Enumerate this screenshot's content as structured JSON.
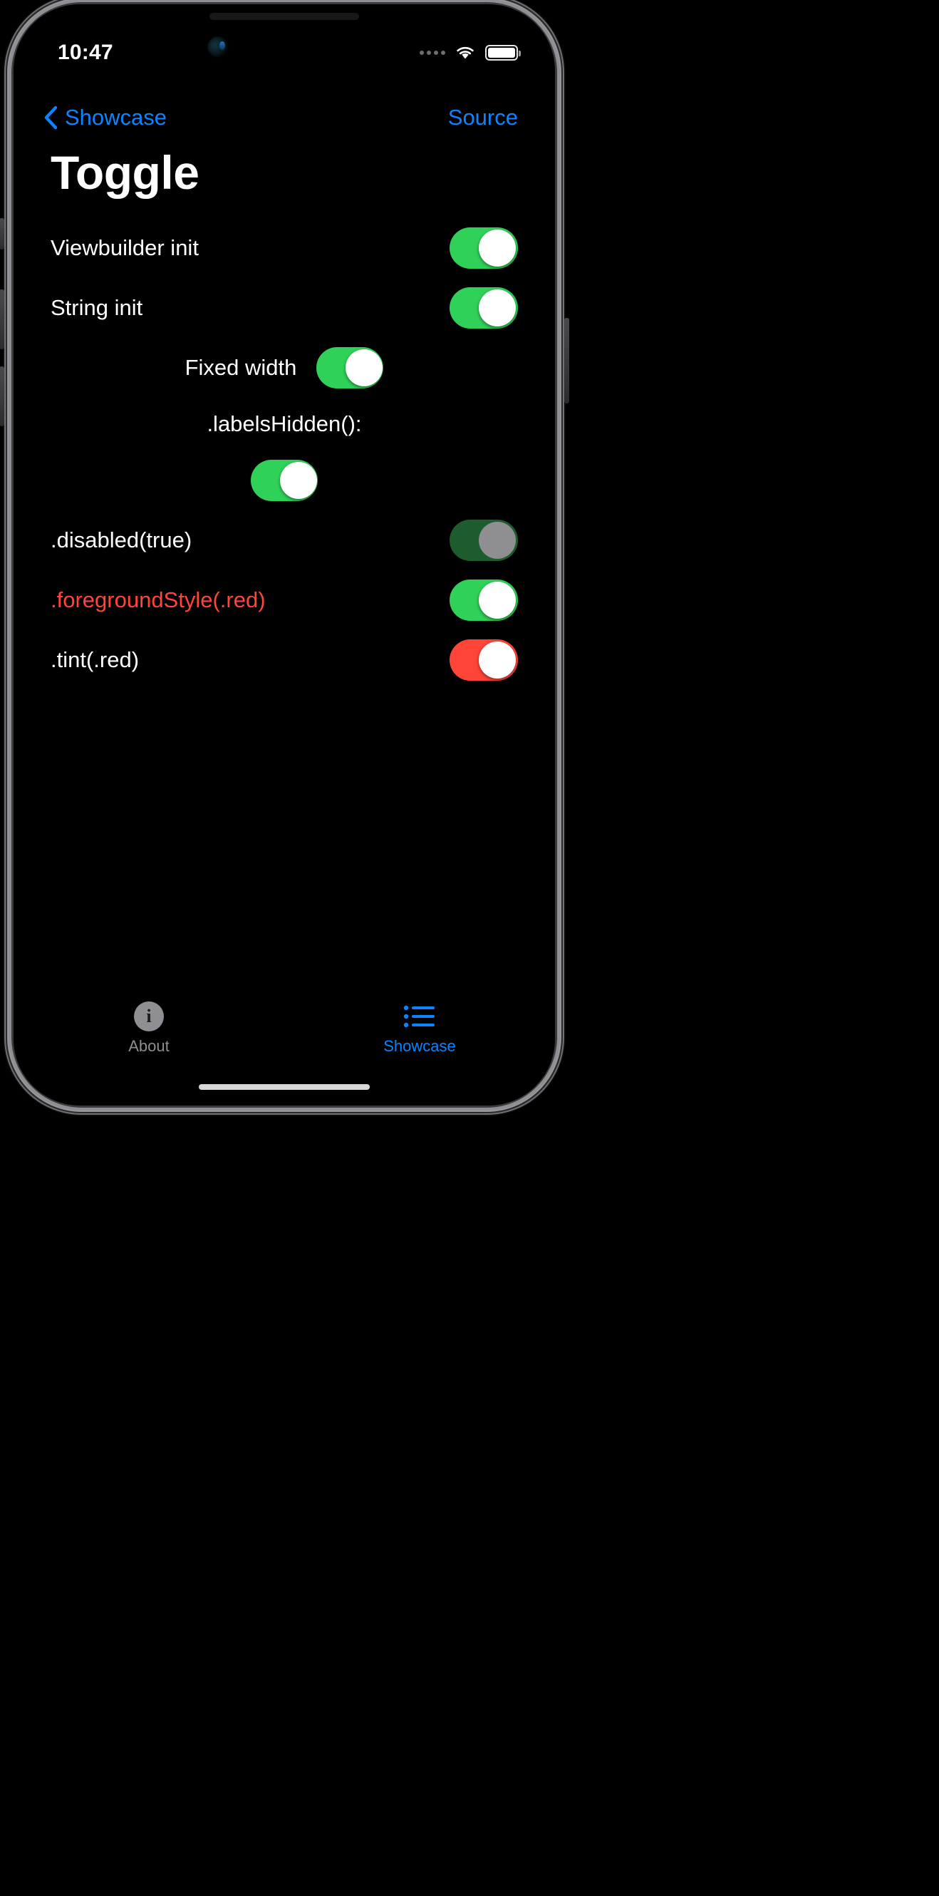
{
  "status_bar": {
    "time": "10:47",
    "cellular_icon": "cellular-dots-icon",
    "wifi_icon": "wifi-icon",
    "battery_icon": "battery-icon"
  },
  "nav_bar": {
    "back_icon": "chevron-left-icon",
    "back_label": "Showcase",
    "source_label": "Source"
  },
  "page_title": "Toggle",
  "rows": [
    {
      "label": "Viewbuilder init",
      "state": "on",
      "style": "default"
    },
    {
      "label": "String init",
      "state": "on",
      "style": "default"
    },
    {
      "label": "Fixed width",
      "state": "on",
      "style": "centered"
    },
    {
      "label": ".labelsHidden():",
      "state": "on",
      "style": "labels-hidden"
    },
    {
      "label": ".disabled(true)",
      "state": "on-disabled",
      "style": "default"
    },
    {
      "label": ".foregroundStyle(.red)",
      "state": "on",
      "style": "red-text"
    },
    {
      "label": ".tint(.red)",
      "state": "on-red",
      "style": "red-tint"
    }
  ],
  "tab_bar": {
    "tabs": [
      {
        "label": "About",
        "icon": "info-circle-icon",
        "active": false
      },
      {
        "label": "Showcase",
        "icon": "list-bullet-icon",
        "active": true
      }
    ]
  },
  "colors": {
    "accent_blue": "#0a84ff",
    "switch_green": "#30d158",
    "switch_red": "#ff443a",
    "disabled_track": "#1d5c2c",
    "disabled_knob": "#8e8e93",
    "background": "#000000",
    "label_white": "#ffffff",
    "inactive_gray": "#8e8e93"
  }
}
